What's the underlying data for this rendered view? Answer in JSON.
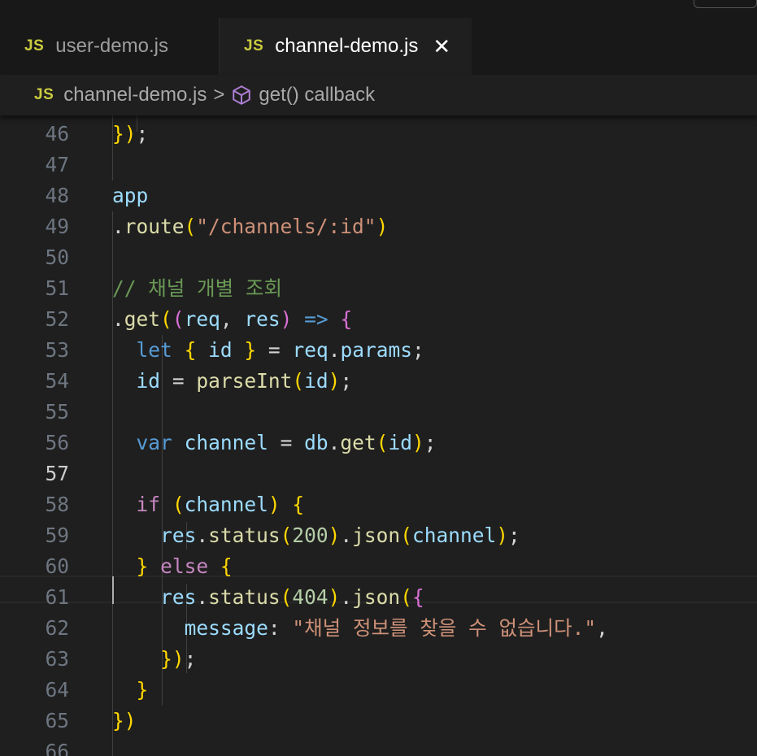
{
  "tabs": [
    {
      "icon": "JS",
      "label": "user-demo.js",
      "active": false
    },
    {
      "icon": "JS",
      "label": "channel-demo.js",
      "active": true,
      "close": "✕"
    }
  ],
  "breadcrumb": {
    "icon": "JS",
    "file": "channel-demo.js",
    "separator": ">",
    "symbol": "get() callback"
  },
  "lines": [
    {
      "n": "46",
      "t": "  });"
    },
    {
      "n": "47",
      "t": ""
    },
    {
      "n": "48",
      "t": "app"
    },
    {
      "n": "49",
      "t": "  .route(\"/channels/:id\")"
    },
    {
      "n": "50",
      "t": ""
    },
    {
      "n": "51",
      "t": "  // 채널 개별 조회"
    },
    {
      "n": "52",
      "t": "  .get((req, res) => {"
    },
    {
      "n": "53",
      "t": "    let { id } = req.params;"
    },
    {
      "n": "54",
      "t": "    id = parseInt(id);"
    },
    {
      "n": "55",
      "t": ""
    },
    {
      "n": "56",
      "t": "    var channel = db.get(id);"
    },
    {
      "n": "57",
      "t": ""
    },
    {
      "n": "58",
      "t": "    if (channel) {"
    },
    {
      "n": "59",
      "t": "      res.status(200).json(channel);"
    },
    {
      "n": "60",
      "t": "    } else {"
    },
    {
      "n": "61",
      "t": "      res.status(404).json({"
    },
    {
      "n": "62",
      "t": "        message: \"채널 정보를 찾을 수 없습니다.\","
    },
    {
      "n": "63",
      "t": "      });"
    },
    {
      "n": "64",
      "t": "    }"
    },
    {
      "n": "65",
      "t": "  })"
    },
    {
      "n": "66",
      "t": ""
    }
  ],
  "active_line": "57",
  "colors": {
    "editor_bg": "#1f1f1f",
    "tab_bar_bg": "#181818",
    "js_icon": "#cbcb41",
    "keyword": "#569cd6",
    "string": "#ce9178",
    "comment": "#6a9955"
  }
}
